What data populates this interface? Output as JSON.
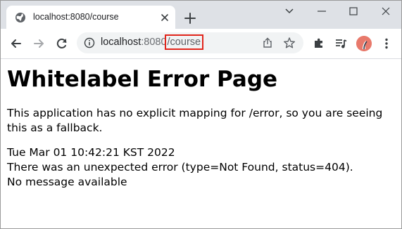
{
  "browser": {
    "tab": {
      "title": "localhost:8080/course"
    },
    "address_bar": {
      "host": "localhost",
      "port": ":8080",
      "path": "/course",
      "highlight_color": "#e1251b"
    },
    "icons": {
      "tab": [
        "globe-icon",
        "close-icon"
      ],
      "strip": [
        "new-tab-icon",
        "chevron-down-icon",
        "minimize-icon",
        "maximize-icon",
        "close-window-icon"
      ],
      "toolbar": [
        "back-icon",
        "forward-icon",
        "reload-icon",
        "info-icon",
        "share-icon",
        "star-icon",
        "extensions-icon",
        "media-icon",
        "avatar",
        "menu-icon"
      ]
    }
  },
  "page": {
    "heading": "Whitelabel Error Page",
    "description": "This application has no explicit mapping for /error, so you are seeing this as a fallback.",
    "timestamp": "Tue Mar 01 10:42:21 KST 2022",
    "error_line": "There was an unexpected error (type=Not Found, status=404).",
    "message": "No message available"
  }
}
